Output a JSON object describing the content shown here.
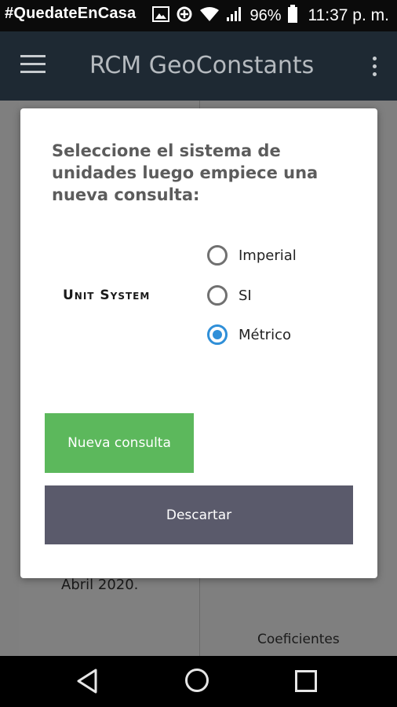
{
  "status_bar": {
    "hashtag": "#QuedateEnCasa",
    "battery_percent": "96%",
    "time": "11:37 p. m.",
    "icons": [
      "image-icon",
      "data-saver-icon",
      "wifi-icon",
      "signal-icon",
      "battery-icon"
    ]
  },
  "app_bar": {
    "title": "RCM GeoConstants",
    "icons": [
      "menu-icon",
      "more-vert-icon"
    ]
  },
  "background": {
    "date_text": "Abril 2020.",
    "coefficients_text": "Coeficientes"
  },
  "dialog": {
    "title": "Seleccione el sistema de unidades luego empiece una nueva consulta:",
    "unit_label": "Unit System",
    "options": [
      {
        "label": "Imperial",
        "checked": false
      },
      {
        "label": "SI",
        "checked": false
      },
      {
        "label": "Métrico",
        "checked": true
      }
    ],
    "new_query_label": "Nueva consulta",
    "dismiss_label": "Descartar"
  },
  "colors": {
    "app_bar": "#1e2933",
    "accent": "#2f8fd8",
    "new_query_button": "#5cb85c",
    "dismiss_button": "#5a5a6b"
  },
  "nav_bar": {
    "icons": [
      "back-icon",
      "home-icon",
      "recents-icon"
    ]
  }
}
